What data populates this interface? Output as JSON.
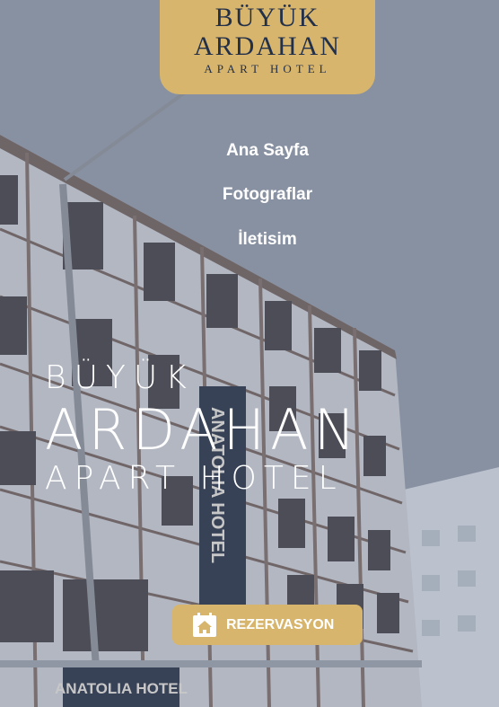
{
  "logo": {
    "line1": "BÜYÜK",
    "line2": "ARDAHAN",
    "line3": "APART HOTEL"
  },
  "nav": [
    {
      "label": "Ana Sayfa"
    },
    {
      "label": "Fotograflar"
    },
    {
      "label": "İletisim"
    }
  ],
  "hero": {
    "line1": "BÜYÜK",
    "line2": "ARDAHAN",
    "line3": "APART HOTEL"
  },
  "reservation": {
    "label": "REZERVASYON",
    "icon": "calendar-house-icon"
  },
  "background_signs": {
    "vertical_sign": "ANATOLIA HOTEL",
    "bottom_sign": "ANATOLIA HOTEL"
  },
  "colors": {
    "accent": "#d7b56d",
    "logo_text": "#23304a",
    "overlay": "#8e96a6"
  }
}
